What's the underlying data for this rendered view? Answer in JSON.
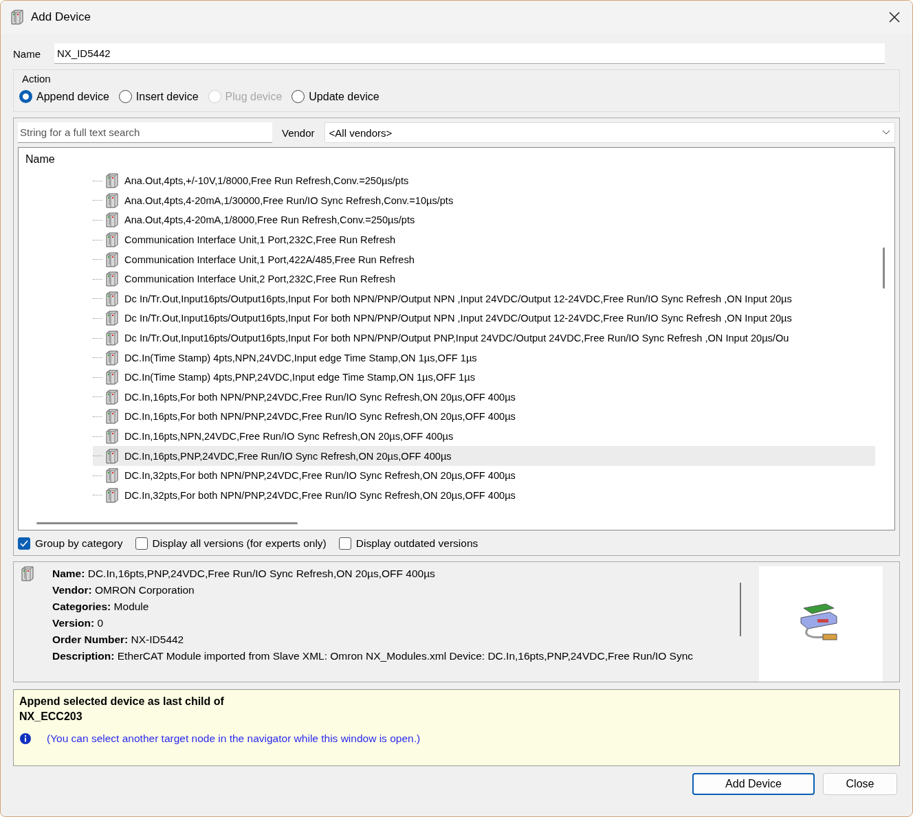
{
  "window": {
    "title": "Add Device"
  },
  "name_field": {
    "label": "Name",
    "value": "NX_ID5442"
  },
  "action": {
    "title": "Action",
    "options": [
      {
        "label": "Append device",
        "selected": true,
        "disabled": false
      },
      {
        "label": "Insert device",
        "selected": false,
        "disabled": false
      },
      {
        "label": "Plug device",
        "selected": false,
        "disabled": true
      },
      {
        "label": "Update device",
        "selected": false,
        "disabled": false
      }
    ]
  },
  "search": {
    "placeholder": "String for a full text search"
  },
  "vendor": {
    "label": "Vendor",
    "value": "<All vendors>"
  },
  "list": {
    "column": "Name",
    "rows": [
      {
        "label": "Ana.Out,4pts,+/-10V,1/8000,Free Run Refresh,Conv.=250µs/pts",
        "selected": false
      },
      {
        "label": "Ana.Out,4pts,4-20mA,1/30000,Free Run/IO Sync Refresh,Conv.=10µs/pts",
        "selected": false
      },
      {
        "label": "Ana.Out,4pts,4-20mA,1/8000,Free Run Refresh,Conv.=250µs/pts",
        "selected": false
      },
      {
        "label": "Communication Interface Unit,1 Port,232C,Free Run Refresh",
        "selected": false
      },
      {
        "label": "Communication Interface Unit,1 Port,422A/485,Free Run Refresh",
        "selected": false
      },
      {
        "label": "Communication Interface Unit,2 Port,232C,Free Run Refresh",
        "selected": false
      },
      {
        "label": "Dc In/Tr.Out,Input16pts/Output16pts,Input For both NPN/PNP/Output NPN ,Input 24VDC/Output 12-24VDC,Free Run/IO Sync Refresh  ,ON Input 20µs",
        "selected": false
      },
      {
        "label": "Dc In/Tr.Out,Input16pts/Output16pts,Input For both NPN/PNP/Output NPN ,Input 24VDC/Output 12-24VDC,Free Run/IO Sync Refresh  ,ON Input 20µs",
        "selected": false
      },
      {
        "label": "Dc In/Tr.Out,Input16pts/Output16pts,Input For both NPN/PNP/Output PNP,Input 24VDC/Output 24VDC,Free Run/IO Sync Refresh  ,ON Input 20µs/Ou",
        "selected": false
      },
      {
        "label": "DC.In(Time Stamp) 4pts,NPN,24VDC,Input edge  Time Stamp,ON 1µs,OFF 1µs",
        "selected": false
      },
      {
        "label": "DC.In(Time Stamp) 4pts,PNP,24VDC,Input edge  Time Stamp,ON 1µs,OFF 1µs",
        "selected": false
      },
      {
        "label": "DC.In,16pts,For both NPN/PNP,24VDC,Free Run/IO Sync Refresh,ON 20µs,OFF 400µs",
        "selected": false
      },
      {
        "label": "DC.In,16pts,For both NPN/PNP,24VDC,Free Run/IO Sync Refresh,ON 20µs,OFF 400µs",
        "selected": false
      },
      {
        "label": "DC.In,16pts,NPN,24VDC,Free Run/IO Sync Refresh,ON 20µs,OFF 400µs",
        "selected": false
      },
      {
        "label": "DC.In,16pts,PNP,24VDC,Free Run/IO Sync Refresh,ON 20µs,OFF 400µs",
        "selected": true
      },
      {
        "label": "DC.In,32pts,For both NPN/PNP,24VDC,Free Run/IO Sync Refresh,ON 20µs,OFF 400µs",
        "selected": false
      },
      {
        "label": "DC.In,32pts,For both NPN/PNP,24VDC,Free Run/IO Sync Refresh,ON 20µs,OFF 400µs",
        "selected": false
      }
    ]
  },
  "options": [
    {
      "label": "Group by category",
      "checked": true
    },
    {
      "label": "Display all versions (for experts only)",
      "checked": false
    },
    {
      "label": "Display outdated versions",
      "checked": false
    }
  ],
  "details": [
    {
      "key": "Name:",
      "value": "DC.In,16pts,PNP,24VDC,Free Run/IO Sync Refresh,ON 20µs,OFF 400µs"
    },
    {
      "key": "Vendor:",
      "value": "OMRON Corporation"
    },
    {
      "key": "Categories:",
      "value": "Module"
    },
    {
      "key": "Version:",
      "value": "0"
    },
    {
      "key": "Order Number:",
      "value": "NX-ID5442"
    },
    {
      "key": "Description:",
      "value": "EtherCAT Module imported from Slave XML: Omron NX_Modules.xml Device: DC.In,16pts,PNP,24VDC,Free Run/IO Sync"
    }
  ],
  "info": {
    "heading": "Append selected device as last child of",
    "target": "NX_ECC203",
    "hint": "(You can select another target node in the navigator while this window is open.)"
  },
  "buttons": [
    {
      "label": "Add Device",
      "kind": "default"
    },
    {
      "label": "Close",
      "kind": "normal"
    }
  ]
}
